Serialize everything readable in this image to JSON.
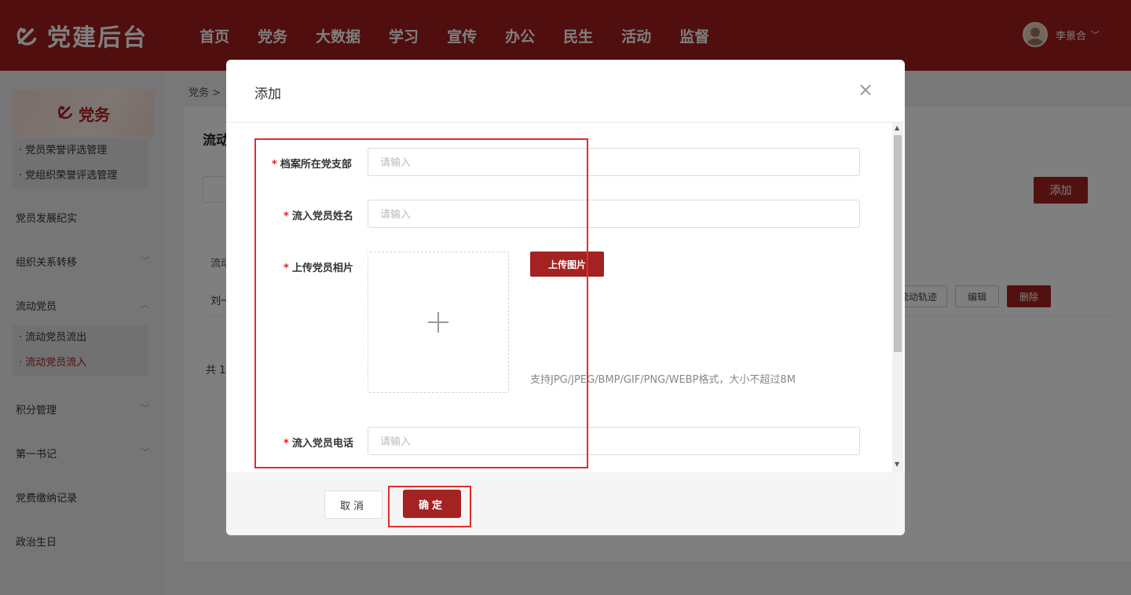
{
  "app": {
    "title": "党建后台"
  },
  "nav": [
    "首页",
    "党务",
    "大数据",
    "学习",
    "宣传",
    "办公",
    "民生",
    "活动",
    "监督"
  ],
  "user": {
    "name": "李景合"
  },
  "sidebar": {
    "banner": "党务",
    "group1": [
      "党员荣誉评选管理",
      "党组织荣誉评选管理"
    ],
    "items": [
      "党员发展纪实",
      "组织关系转移",
      "流动党员"
    ],
    "group2": [
      "流动党员流出",
      "流动党员流入"
    ],
    "items2": [
      "积分管理",
      "第一书记",
      "党费缴纳记录",
      "政治生日"
    ]
  },
  "background": {
    "breadcrumb": "党务 >",
    "panel_title": "流动",
    "add_label": "添加",
    "col_header": "流动",
    "cell": "刘一",
    "actions": [
      "流动轨迹",
      "编辑",
      "删除"
    ],
    "total": "共 1"
  },
  "modal": {
    "title": "添加",
    "fields": [
      {
        "label": "档案所在党支部",
        "placeholder": "请输入"
      },
      {
        "label": "流入党员姓名",
        "placeholder": "请输入"
      },
      {
        "label": "上传党员相片"
      },
      {
        "label": "流入党员电话",
        "placeholder": "请输入"
      }
    ],
    "upload_label": "上传图片",
    "upload_hint": "支持JPG/JPEG/BMP/GIF/PNG/WEBP格式，大小不超过8M",
    "cancel_label": "取消",
    "ok_label": "确定"
  },
  "colors": {
    "brand": "#a01d1d",
    "button": "#a42222",
    "highlight": "#e32b2b"
  }
}
